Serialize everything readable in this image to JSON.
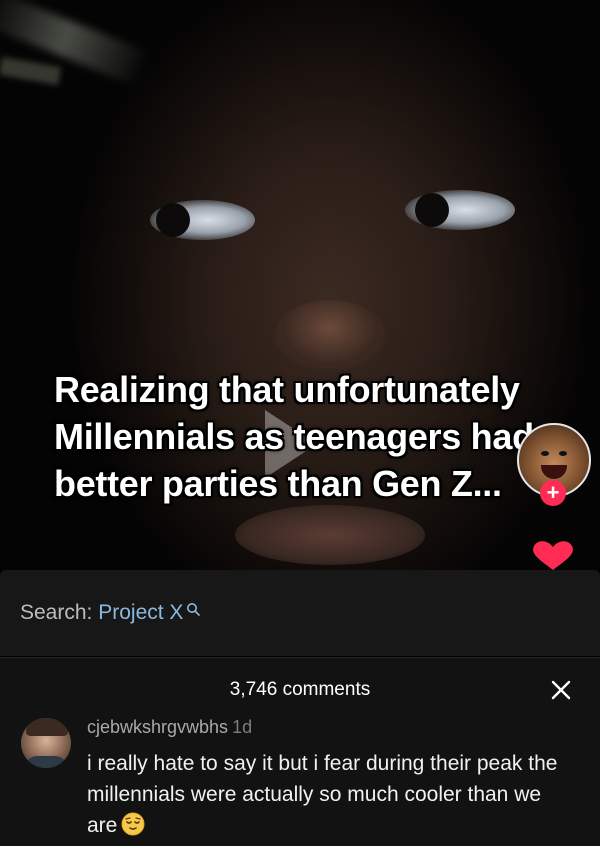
{
  "video": {
    "caption": "Realizing that unfortunately\nMillennials as teenagers had\nbetter parties than Gen Z...",
    "follow_icon": "+",
    "like_icon": "heart-icon"
  },
  "search": {
    "label": "Search: ",
    "term": "Project X",
    "icon": "search-icon"
  },
  "comments_panel": {
    "count_text": "3,746 comments",
    "close_icon": "close-icon",
    "items": [
      {
        "username": "cjebwkshrgvwbhs",
        "time": "1d",
        "text": "i really hate to say it but i fear during their peak the millennials were actually so much cooler than we are",
        "emoji": "relieved-face-emoji"
      }
    ]
  },
  "colors": {
    "accent_red": "#fe2c55",
    "search_term_blue": "#8ab8e0",
    "panel_bg": "#121212"
  }
}
